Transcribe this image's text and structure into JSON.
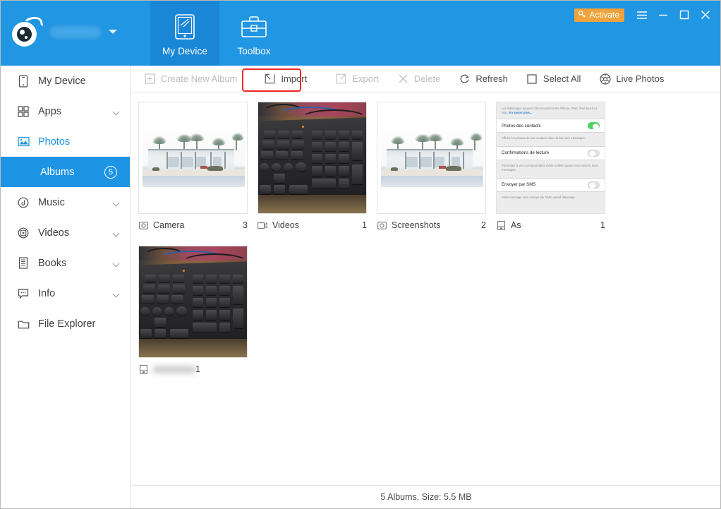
{
  "window": {
    "activate_label": "Activate",
    "key_icon": "key-icon",
    "menu_icon": "hamburger-menu-icon",
    "minimize_icon": "minimize-icon",
    "maximize_icon": "maximize-icon",
    "close_icon": "close-icon"
  },
  "brand": {
    "logo_icon": "itools-eye-logo",
    "device_name": "",
    "caret_icon": "chevron-down-icon"
  },
  "tabs": [
    {
      "label": "My Device",
      "icon": "tablet-icon",
      "active": true
    },
    {
      "label": "Toolbox",
      "icon": "toolbox-icon",
      "active": false
    }
  ],
  "sidebar": {
    "items": [
      {
        "label": "My Device",
        "icon": "phone-icon",
        "expandable": false,
        "active": false
      },
      {
        "label": "Apps",
        "icon": "grid-apps-icon",
        "expandable": true,
        "active": false
      },
      {
        "label": "Photos",
        "icon": "photo-icon",
        "expandable": false,
        "active": true
      },
      {
        "label": "Music",
        "icon": "music-disc-icon",
        "expandable": true,
        "active": false
      },
      {
        "label": "Videos",
        "icon": "video-play-icon",
        "expandable": true,
        "active": false
      },
      {
        "label": "Books",
        "icon": "book-icon",
        "expandable": true,
        "active": false
      },
      {
        "label": "Info",
        "icon": "message-info-icon",
        "expandable": true,
        "active": false
      },
      {
        "label": "File Explorer",
        "icon": "folder-icon",
        "expandable": false,
        "active": false
      }
    ],
    "sub_item": {
      "label": "Albums",
      "count": "5"
    }
  },
  "toolbar": {
    "items": [
      {
        "label": "Create New Album",
        "icon": "plus-box-icon",
        "disabled": true
      },
      {
        "label": "Import",
        "icon": "import-arrow-icon",
        "disabled": false,
        "highlighted": true
      },
      {
        "label": "Export",
        "icon": "export-arrow-icon",
        "disabled": true
      },
      {
        "label": "Delete",
        "icon": "x-delete-icon",
        "disabled": true
      },
      {
        "label": "Refresh",
        "icon": "refresh-circular-arrow-icon",
        "disabled": false
      },
      {
        "label": "Select All",
        "icon": "checkbox-empty-icon",
        "disabled": false
      },
      {
        "label": "Live Photos",
        "icon": "live-photos-icon",
        "disabled": false
      }
    ],
    "highlight_color": "#ef2a20"
  },
  "albums": [
    {
      "name": "Camera",
      "count": "3",
      "icon": "camera-icon",
      "art": "beach",
      "blurred": false
    },
    {
      "name": "Videos",
      "count": "1",
      "icon": "video-camera-icon",
      "art": "keyboard",
      "blurred": false
    },
    {
      "name": "Screenshots",
      "count": "2",
      "icon": "camera-icon",
      "art": "beach",
      "blurred": false
    },
    {
      "name": "As",
      "count": "1",
      "icon": "device-icon",
      "art": "ios-settings",
      "blurred": false
    },
    {
      "name": "",
      "count": "1",
      "icon": "device-icon",
      "art": "keyboard",
      "blurred": true
    }
  ],
  "ios_screenshot": {
    "note": "Les iMessages peuvent être envoyés entre iPhone, iPad, iPod touch et Mac.",
    "note_link": "En savoir plus...",
    "rows": [
      {
        "label": "Photos des contacts",
        "toggle": "on",
        "desc": "Affiche les photos de vos contacts dans la liste des messages."
      },
      {
        "label": "Confirmations de lecture",
        "toggle": "off",
        "desc": "Permettez à vos correspondants d'être notifiés quand vous avez lu leurs messages."
      },
      {
        "label": "Envoyer par SMS",
        "toggle": "off",
        "desc": "Votre message sera envoyé par SMS quand iMessage"
      }
    ]
  },
  "statusbar": {
    "text": "5 Albums, Size: 5.5 MB"
  },
  "colors": {
    "header_blue": "#2196e3",
    "active_tab_blue": "#1a87d6",
    "selected_blue": "#1e94e4",
    "accent_orange": "#f0a33c",
    "highlight_red": "#ef2a20"
  }
}
